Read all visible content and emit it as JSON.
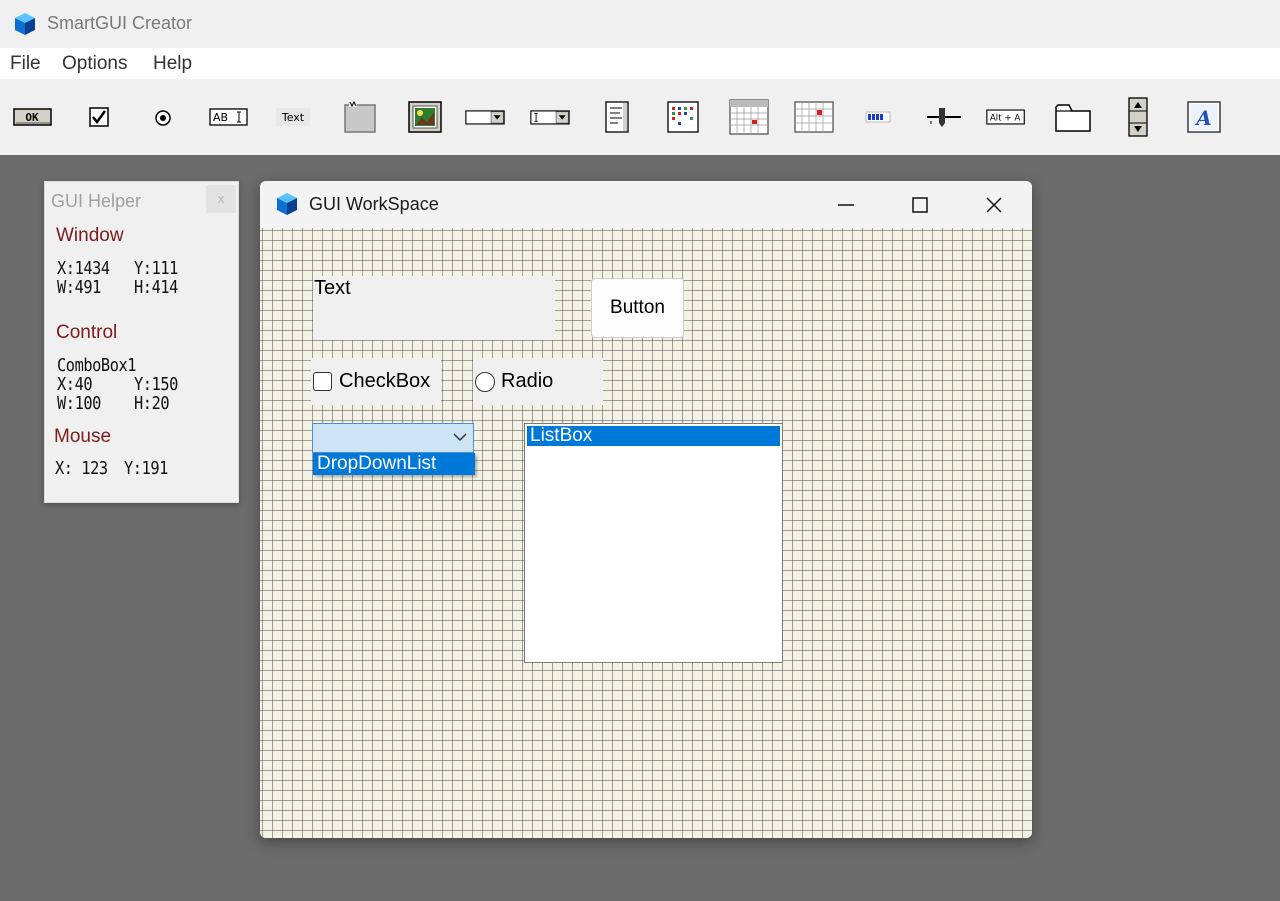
{
  "app": {
    "title": "SmartGUI Creator"
  },
  "menu": [
    "File",
    "Options",
    "Help"
  ],
  "toolbar": {
    "items": [
      {
        "name": "button-tool",
        "label": "OK"
      },
      {
        "name": "checkbox-tool"
      },
      {
        "name": "radio-tool"
      },
      {
        "name": "edit-tool",
        "label": "AB"
      },
      {
        "name": "text-tool",
        "label": "Text"
      },
      {
        "name": "groupbox-tool"
      },
      {
        "name": "picture-tool"
      },
      {
        "name": "dropdownlist-tool"
      },
      {
        "name": "combobox-tool"
      },
      {
        "name": "listbox-tool"
      },
      {
        "name": "listview-tool"
      },
      {
        "name": "datetime-tool"
      },
      {
        "name": "monthcal-tool"
      },
      {
        "name": "progress-tool"
      },
      {
        "name": "slider-tool"
      },
      {
        "name": "hotkey-tool",
        "label": "Alt + A"
      },
      {
        "name": "tab-tool"
      },
      {
        "name": "updown-tool"
      },
      {
        "name": "font-tool",
        "label": "A"
      }
    ]
  },
  "helper": {
    "title": "GUI Helper",
    "close": "x",
    "window": {
      "label": "Window",
      "x": "X:1434",
      "y": "Y:111",
      "w": "W:491",
      "h": "H:414"
    },
    "control": {
      "label": "Control",
      "name": "ComboBox1",
      "x": "X:40",
      "y": "Y:150",
      "w": "W:100",
      "h": "H:20"
    },
    "mouse": {
      "label": "Mouse",
      "x": "X: 123",
      "y": "Y:191"
    }
  },
  "workspace": {
    "title": "GUI WorkSpace",
    "controls": {
      "text": "Text",
      "button": "Button",
      "checkbox": "CheckBox",
      "radio": "Radio",
      "dropdown_item": "DropDownList",
      "listbox_item": "ListBox"
    }
  },
  "colors": {
    "selection": "#0078d7",
    "section_label": "#7a1c1c",
    "canvas": "#f4f2e4"
  }
}
